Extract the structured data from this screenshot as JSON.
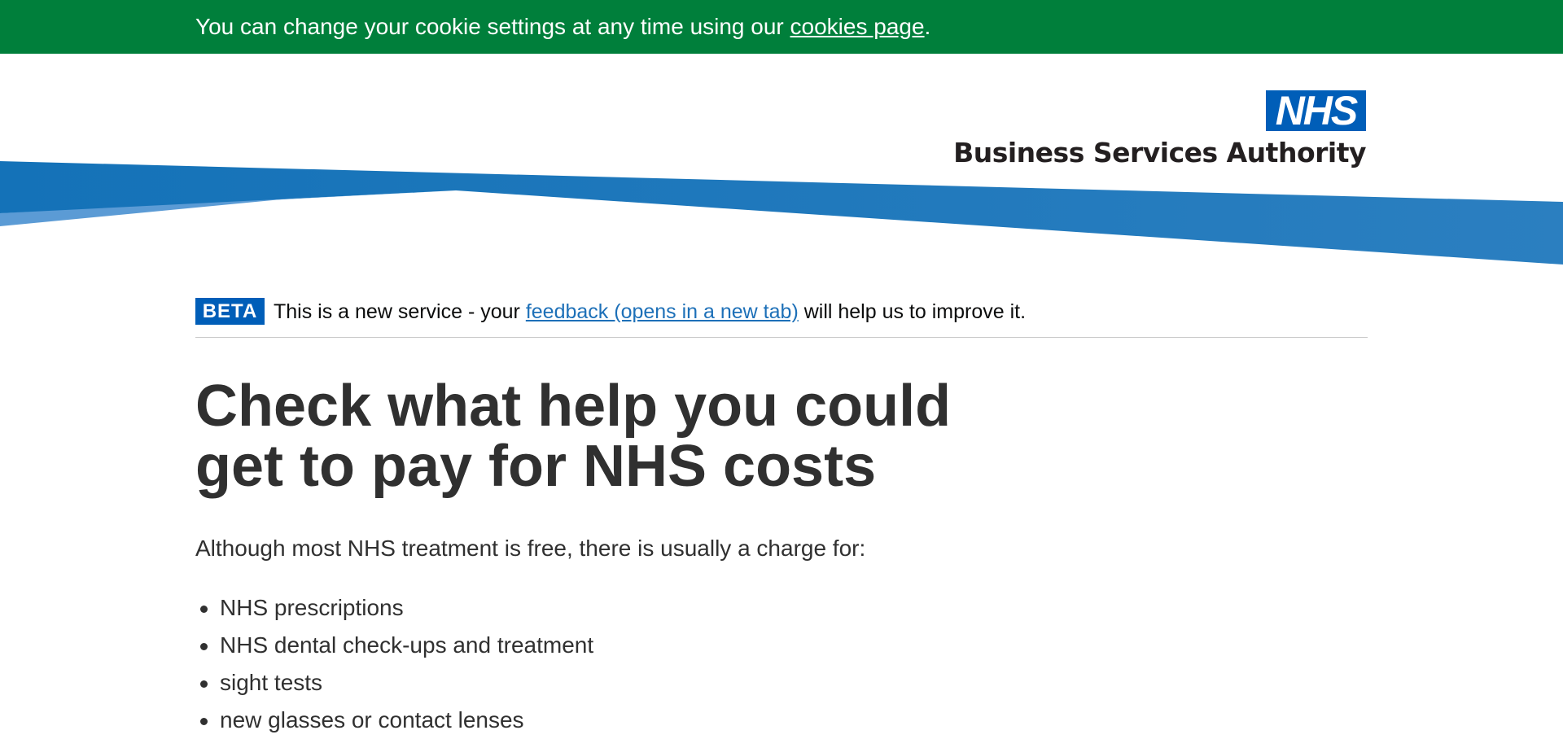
{
  "cookie_banner": {
    "text_before": "You can change your cookie settings at any time using our ",
    "link_label": "cookies page",
    "text_after": "."
  },
  "header": {
    "logo_text": "NHS",
    "org_name": "Business Services Authority"
  },
  "beta_banner": {
    "tag": "BETA",
    "text_before": "This is a new service - your ",
    "link_label": "feedback (opens in a new tab)",
    "text_after": " will help us to improve it."
  },
  "main": {
    "title": "Check what help you could get to pay for NHS costs",
    "intro": "Although most NHS treatment is free, there is usually a charge for:",
    "charges": [
      "NHS prescriptions",
      "NHS dental check-ups and treatment",
      "sight tests",
      "new glasses or contact lenses"
    ]
  },
  "colors": {
    "cookie_banner_bg": "#007f3b",
    "nhs_blue": "#005eb8",
    "link_blue": "#1d70b8",
    "wave_blue": "#1f78bd",
    "wave_light_blue": "#5b9bd5"
  }
}
